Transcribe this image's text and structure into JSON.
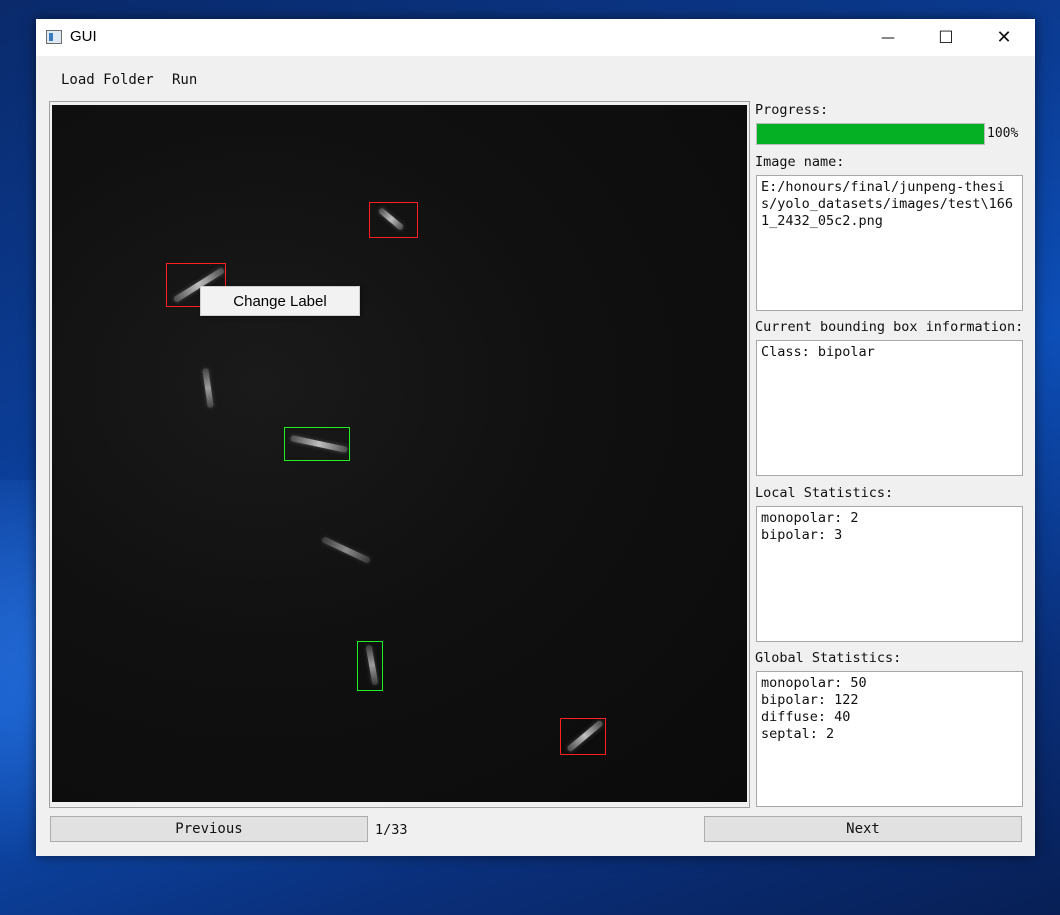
{
  "window": {
    "title": "GUI"
  },
  "title_buttons": {
    "minimize": "—",
    "maximize": "☐",
    "close": "✕"
  },
  "menu": {
    "items": [
      "Load Folder",
      "Run"
    ]
  },
  "context_menu": {
    "item": "Change Label"
  },
  "progress": {
    "label": "Progress:",
    "value": 1.0,
    "percent_text": "100%",
    "color": "#06b025"
  },
  "image_name": {
    "label": "Image name:",
    "value": "E:/honours/final/junpeng-thesis/yolo_datasets/images/test\\1661_2432_05c2.png"
  },
  "bbox_info": {
    "label": "Current bounding box information:",
    "value": "Class: bipolar"
  },
  "local_stats": {
    "label": "Local Statistics:",
    "value": "monopolar: 2\nbipolar: 3"
  },
  "global_stats": {
    "label": "Global Statistics:",
    "value": "monopolar: 50\nbipolar: 122\ndiffuse: 40\nseptal: 2"
  },
  "navigation": {
    "previous": "Previous",
    "next": "Next",
    "page": "1/33"
  },
  "bbox_colors": {
    "red": "#ff2020",
    "green": "#22ee22"
  }
}
